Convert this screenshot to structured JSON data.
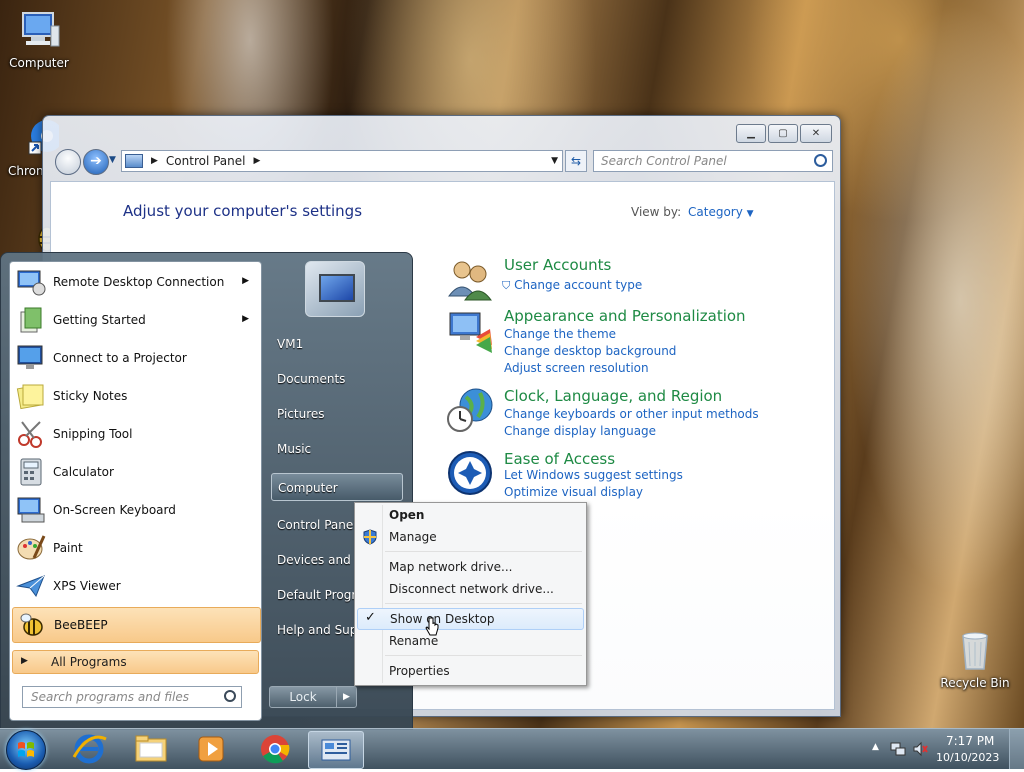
{
  "desktop": {
    "icons": [
      {
        "label": "Computer"
      },
      {
        "label": "Chron"
      },
      {
        "label": "Recycle Bin"
      }
    ]
  },
  "window": {
    "controls": {
      "minimize": "▁",
      "maximize": "▢",
      "close": "✕"
    },
    "address": {
      "crumb": "Control Panel"
    },
    "search_placeholder": "Search Control Panel",
    "heading": "Adjust your computer's settings",
    "view_by_label": "View by:",
    "view_by_value": "Category",
    "categories": [
      {
        "title": "User Accounts",
        "links": [
          "Change account type"
        ]
      },
      {
        "title": "Appearance and Personalization",
        "links": [
          "Change the theme",
          "Change desktop background",
          "Adjust screen resolution"
        ]
      },
      {
        "title": "Clock, Language, and Region",
        "links": [
          "Change keyboards or other input methods",
          "Change display language"
        ]
      },
      {
        "title": "Ease of Access",
        "links": [
          "Let Windows suggest settings",
          "Optimize visual display"
        ]
      }
    ]
  },
  "start_menu": {
    "programs": [
      {
        "label": "Remote Desktop Connection",
        "submenu": true
      },
      {
        "label": "Getting Started",
        "submenu": true
      },
      {
        "label": "Connect to a Projector"
      },
      {
        "label": "Sticky Notes"
      },
      {
        "label": "Snipping Tool"
      },
      {
        "label": "Calculator"
      },
      {
        "label": "On-Screen Keyboard"
      },
      {
        "label": "Paint"
      },
      {
        "label": "XPS Viewer"
      },
      {
        "label": "BeeBEEP"
      }
    ],
    "all_programs": "All Programs",
    "search_placeholder": "Search programs and files",
    "right_links": [
      "VM1",
      "Documents",
      "Pictures",
      "Music",
      "Computer",
      "Control Panel",
      "Devices and Printers",
      "Default Programs",
      "Help and Support"
    ],
    "lock_label": "Lock"
  },
  "context_menu": {
    "items": [
      "Open",
      "Manage",
      "Map network drive...",
      "Disconnect network drive...",
      "Show on Desktop",
      "Rename",
      "Properties"
    ],
    "checked_item": "Show on Desktop"
  },
  "taskbar": {
    "clock_time": "7:17 PM",
    "clock_date": "10/10/2023"
  }
}
